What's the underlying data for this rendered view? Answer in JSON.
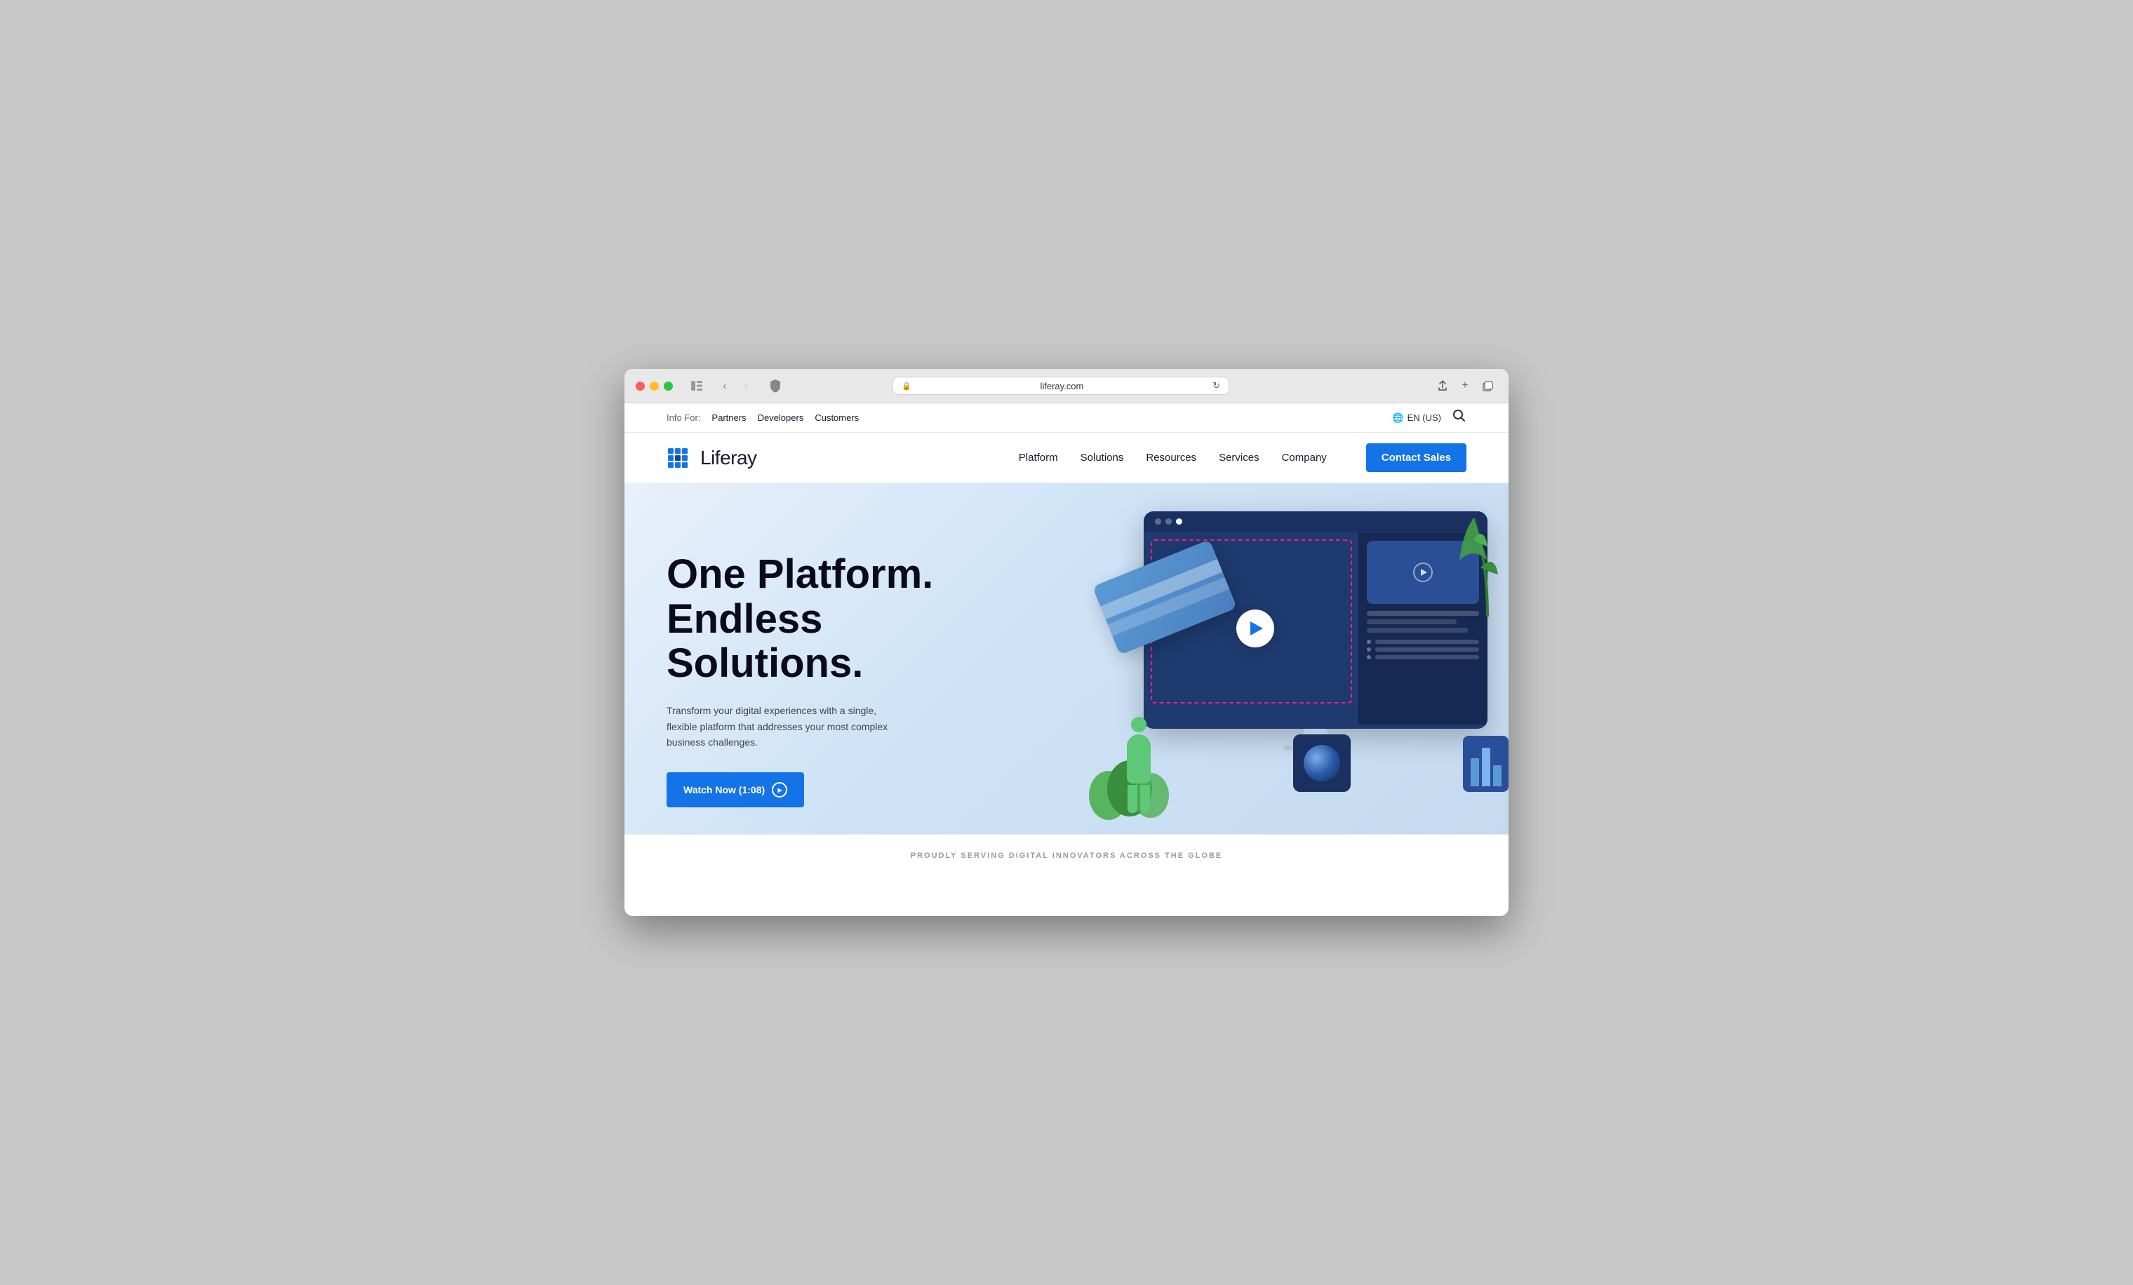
{
  "browser": {
    "url": "liferay.com",
    "lock_icon": "🔒",
    "refresh_icon": "↻"
  },
  "info_bar": {
    "label": "Info For:",
    "links": [
      "Partners",
      "Developers",
      "Customers"
    ],
    "language": "EN (US)",
    "globe_icon": "🌐"
  },
  "nav": {
    "logo_text": "Liferay",
    "links": [
      {
        "label": "Platform"
      },
      {
        "label": "Solutions"
      },
      {
        "label": "Resources"
      },
      {
        "label": "Services"
      },
      {
        "label": "Company"
      }
    ],
    "cta_label": "Contact Sales"
  },
  "hero": {
    "title_line1": "One Platform.",
    "title_line2": "Endless Solutions.",
    "subtitle": "Transform your digital experiences with a single, flexible platform that addresses your most complex business challenges.",
    "watch_btn": "Watch Now (1:08)"
  },
  "bottom_bar": {
    "text": "PROUDLY SERVING DIGITAL INNOVATORS ACROSS THE GLOBE"
  },
  "icons": {
    "sidebar_toggle": "⊞",
    "back": "‹",
    "forward": "›",
    "share": "⬆",
    "new_tab": "+",
    "windows": "⧉",
    "shield": "🛡",
    "search": "⌕"
  }
}
